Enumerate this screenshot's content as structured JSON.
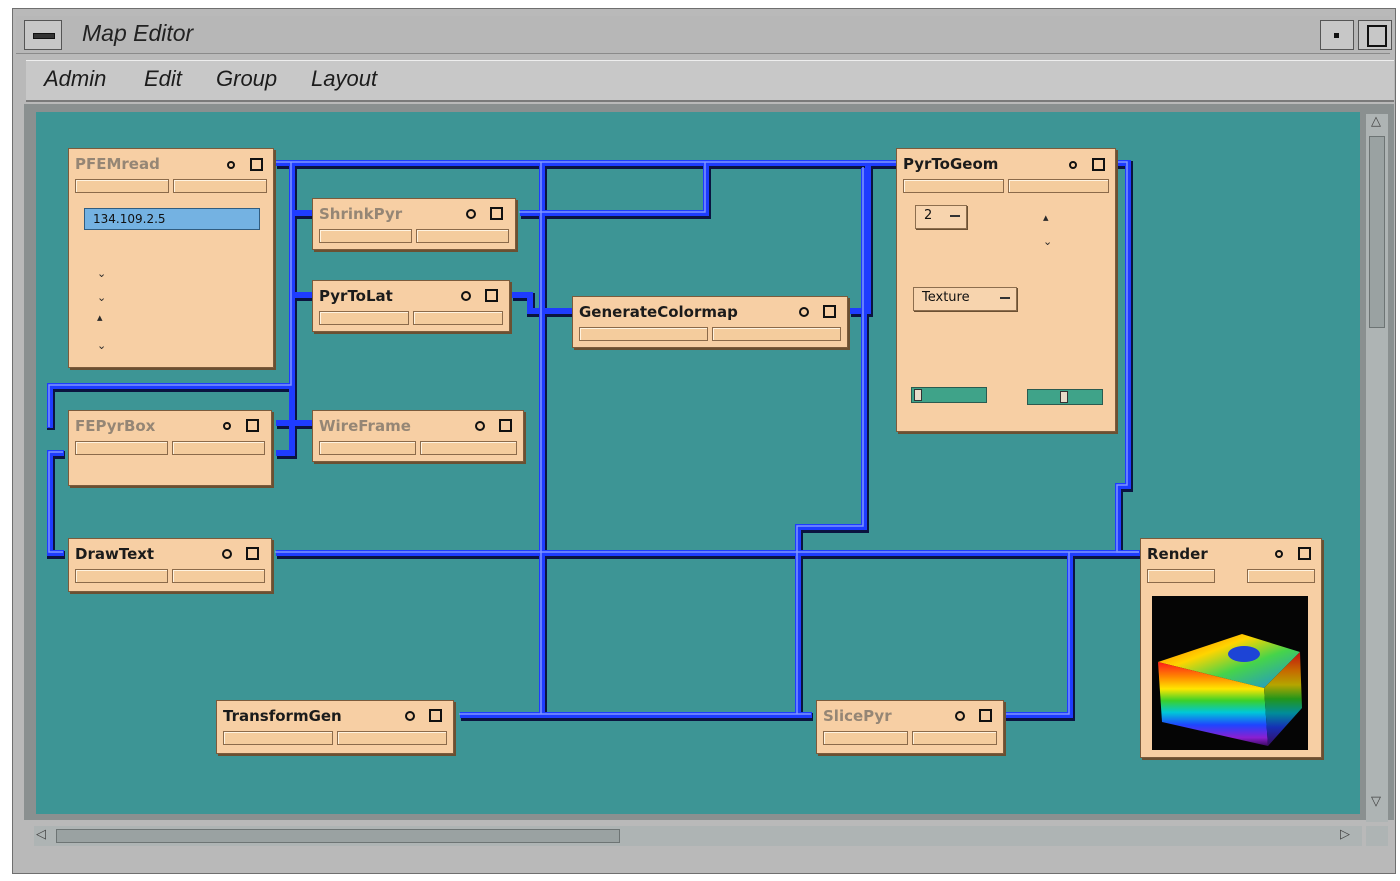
{
  "window": {
    "title": "Map Editor"
  },
  "menu": [
    "Admin",
    "Edit",
    "Group",
    "Layout"
  ],
  "modules": {
    "pfemread": {
      "name": "PFEMread",
      "address": "134.109.2.5"
    },
    "shrinkpyr": {
      "name": "ShrinkPyr"
    },
    "pyrtolat": {
      "name": "PyrToLat"
    },
    "generatecolormap": {
      "name": "GenerateColormap"
    },
    "pyrtogeom": {
      "name": "PyrToGeom",
      "option1": "2",
      "option2": "Texture"
    },
    "fepyrbox": {
      "name": "FEPyrBox"
    },
    "wireframe": {
      "name": "WireFrame"
    },
    "drawtext": {
      "name": "DrawText"
    },
    "render": {
      "name": "Render"
    },
    "transformgen": {
      "name": "TransformGen"
    },
    "slicepyr": {
      "name": "SlicePyr"
    }
  },
  "colors": {
    "canvas": "#3d9595",
    "module": "#f7cfa4",
    "wire": "#1e3cff",
    "field": "#74b2e2"
  }
}
